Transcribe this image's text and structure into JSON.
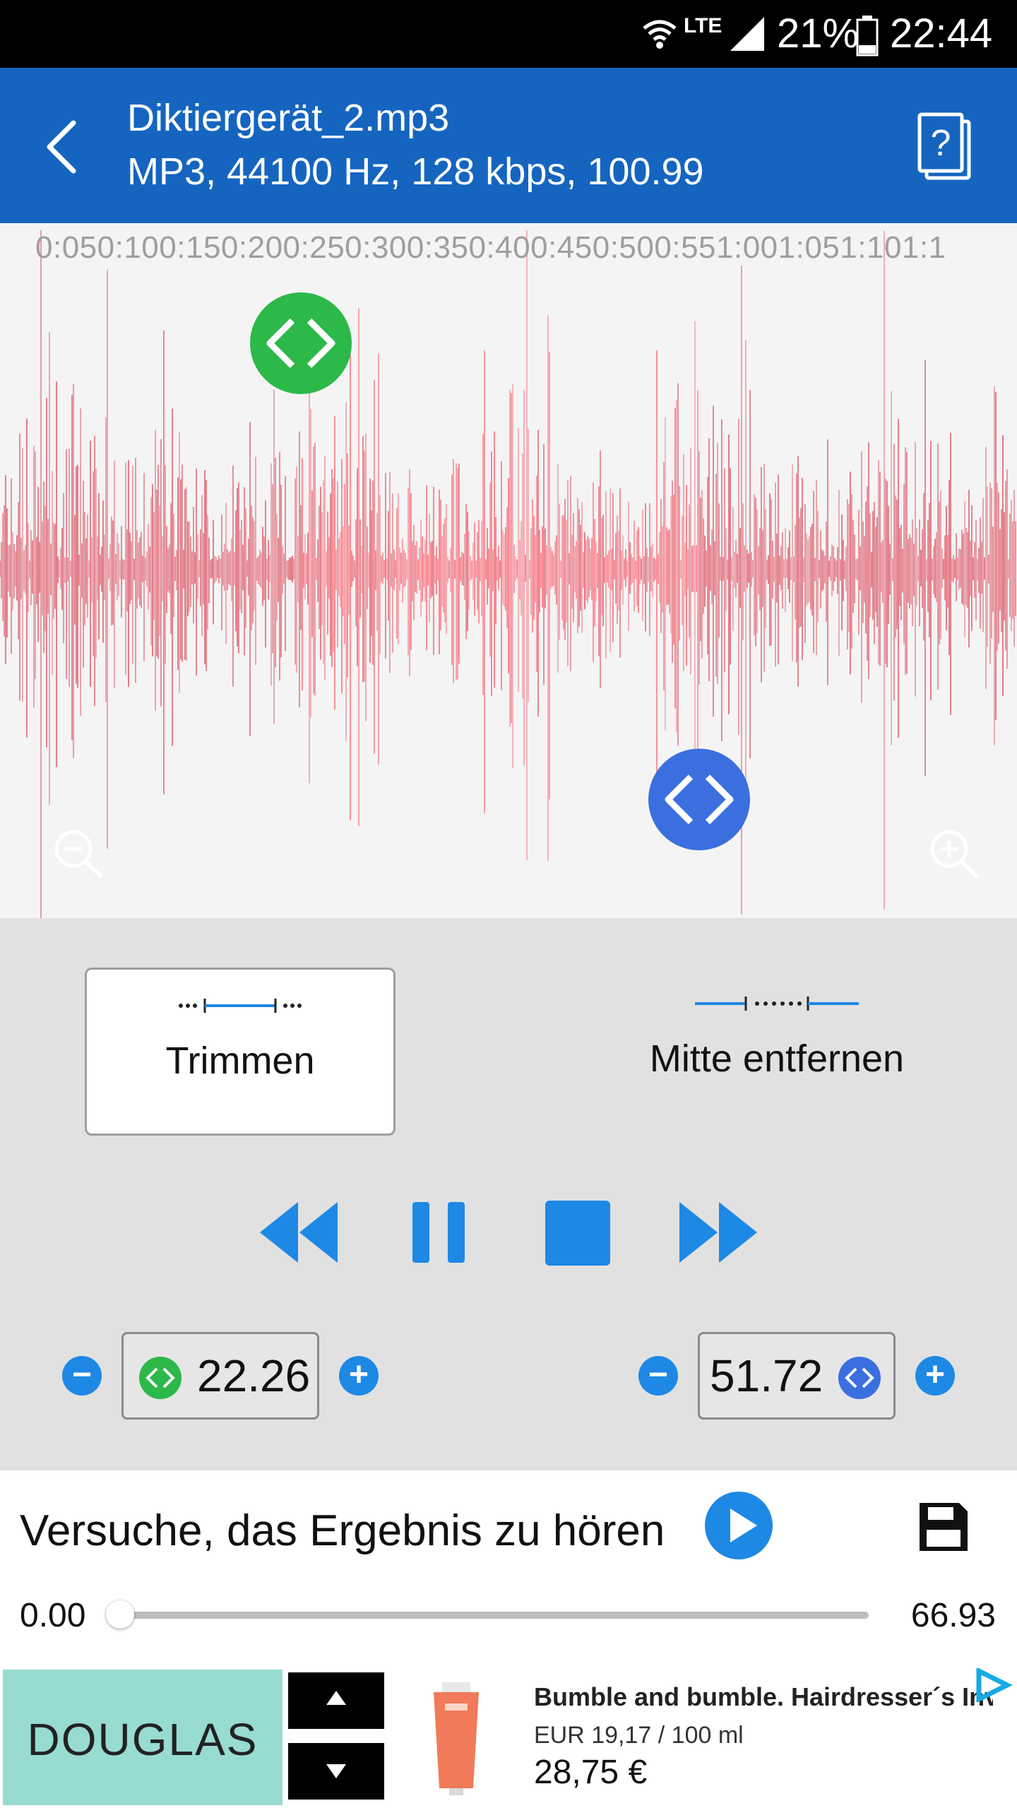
{
  "status_bar": {
    "network": "LTE",
    "battery": "21%",
    "time": "22:44"
  },
  "app_bar": {
    "title": "Diktiergerät_2.mp3",
    "subtitle": "MP3, 44100 Hz, 128 kbps, 100.99",
    "back_icon": "back-arrow-icon",
    "help_icon": "help-document-icon"
  },
  "timeline": {
    "ticks_text": "0:050:100:150:200:250:300:350:400:450:500:551:001:051:101:1"
  },
  "colors": {
    "accent": "#1e88e5",
    "appbar": "#1565c0",
    "waveform": "#d82c3f",
    "selection_waveform": "#ff3b4d",
    "start_marker": "#2db84a",
    "end_marker": "#3b6fe0"
  },
  "modes": {
    "trim_label": "Trimmen",
    "remove_middle_label": "Mitte entfernen"
  },
  "start": {
    "value": "22.26"
  },
  "end": {
    "value": "51.72"
  },
  "preview": {
    "label": "Versuche, das Ergebnis zu hören",
    "position": "0.00",
    "duration": "66.93",
    "progress_fraction": 0
  },
  "ad": {
    "brand": "DOUGLAS",
    "title": "Bumble and bumble. Hairdresser´s Inv...",
    "unit_price": "EUR 19,17 / 100 ml",
    "price": "28,75 €"
  }
}
